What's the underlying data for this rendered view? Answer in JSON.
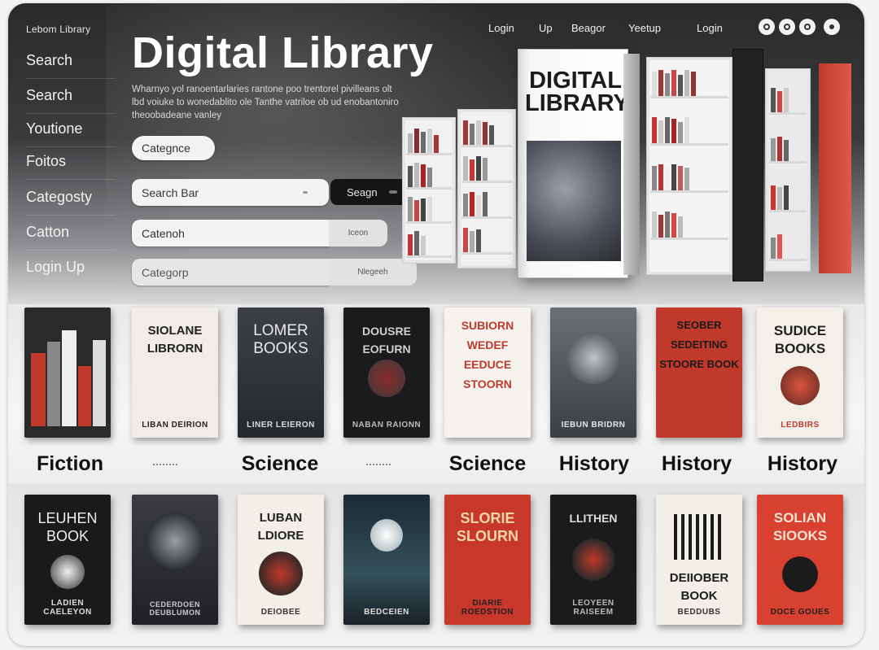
{
  "brand": "Lebom Library",
  "sidebar": {
    "items": [
      {
        "label": "Search"
      },
      {
        "label": "Search"
      },
      {
        "label": "Youtione"
      },
      {
        "label": "Foitos"
      },
      {
        "label": "Categosty"
      },
      {
        "label": "Catton"
      },
      {
        "label": "Login Up"
      }
    ]
  },
  "topnav": {
    "links": [
      "Login",
      "Up",
      "Beagor",
      "Yeetup",
      "Login"
    ],
    "icons": [
      "circle-icon",
      "circle-icon",
      "circle-icon",
      "circle-icon"
    ]
  },
  "hero": {
    "title": "Digital Library",
    "description": "Wharnyo yol ranoentarlaries rantone poo trentorel pivilleans olt lbd voiuke to wonedablito ole Tanthe vatriloe ob ud enobantoniro theoobadeane vanley",
    "category_chip": "Categnce",
    "search_placeholder": "Search Bar",
    "search_button": "Seagn",
    "field2_value": "Catenoh",
    "field2_button": "Iceon",
    "field3_value": "Categorp",
    "field3_button": "Nlegeeh"
  },
  "featured_book": {
    "title_line1": "DIGITAL",
    "title_line2": "LIBRARY"
  },
  "categories": [
    "Fiction",
    "Science",
    "Science",
    "History",
    "History",
    "History"
  ],
  "books_row1": [
    {
      "title": "",
      "author": "",
      "theme": "shelf"
    },
    {
      "title": "SIOLANE LIBRORN",
      "author": "LIBAN DEIRION",
      "theme": "light"
    },
    {
      "title": "LOMER BOOKS",
      "author": "LINER LEIERON",
      "theme": "dark"
    },
    {
      "title": "DOUSRE EOFURN",
      "author": "NABAN RAIONN",
      "theme": "black"
    },
    {
      "title": "SUBIORN WEDEF EEDUCE STOORN",
      "author": "",
      "theme": "cream"
    },
    {
      "title": "",
      "author": "IEBUN BRIDRN",
      "theme": "grey"
    },
    {
      "title": "SEOBER SEDEITING STOORE BOOK",
      "author": "",
      "theme": "red"
    },
    {
      "title": "SUDICE BOOKS",
      "author": "LEDBIRS",
      "theme": "white"
    }
  ],
  "books_row2": [
    {
      "title": "LEUHEN BOOK",
      "author": "LADIEN CAELEYON",
      "theme": "black"
    },
    {
      "title": "",
      "author": "CEDERDOEN DEUBLUMON",
      "theme": "dark"
    },
    {
      "title": "LUBAN LDIORE",
      "author": "DEIOBEE",
      "theme": "white"
    },
    {
      "title": "",
      "author": "BEDCEIEN",
      "theme": "night"
    },
    {
      "title": "SLORIE SLOURN",
      "author": "DIARIE ROEDSTION",
      "theme": "red"
    },
    {
      "title": "LLITHEN",
      "author": "LEOYEEN RAISEEM",
      "theme": "black"
    },
    {
      "title": "DEIIOBER BOOK",
      "author": "BEDDUBS",
      "theme": "white"
    },
    {
      "title": "SOLIAN SIOOKS",
      "author": "DOCE GOUES",
      "theme": "red"
    }
  ],
  "colors": {
    "hero_dark": "#2a2a2c",
    "accent_red": "#c0392b",
    "button_black": "#151515"
  }
}
